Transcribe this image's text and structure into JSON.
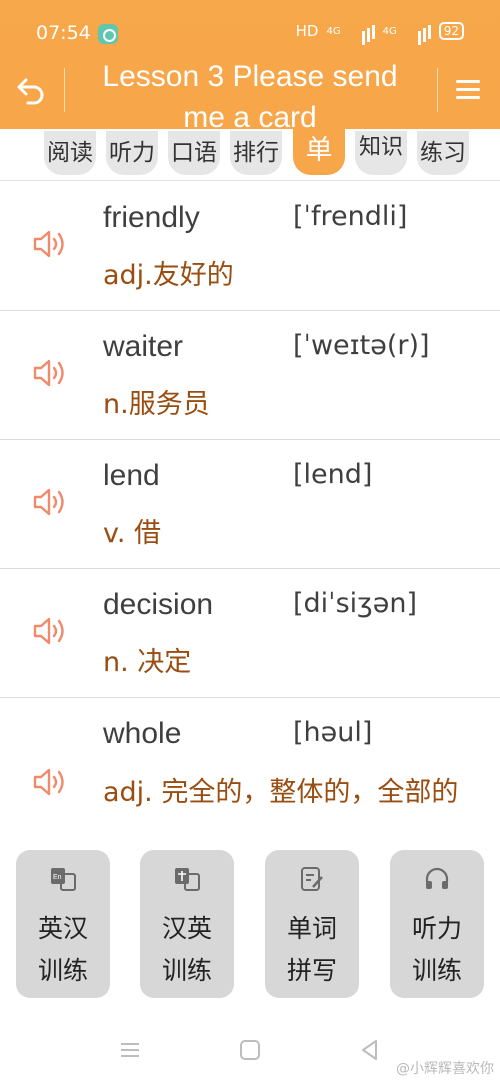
{
  "status_bar": {
    "time": "07:54",
    "network": "HD",
    "signal1": "4G",
    "signal2": "4G",
    "battery": "92"
  },
  "header": {
    "title": "Lesson 3 Please send me a card"
  },
  "tabs": [
    {
      "label": "阅读"
    },
    {
      "label": "听力"
    },
    {
      "label": "口语"
    },
    {
      "label": "排行"
    },
    {
      "label": "单",
      "active": true
    },
    {
      "label": "知识"
    },
    {
      "label": "练习"
    }
  ],
  "words": [
    {
      "word": "friendly",
      "phonetic": "[ˈfrendli]",
      "meaning": "adj.友好的"
    },
    {
      "word": "waiter",
      "phonetic": "[ˈweɪtə(r)]",
      "meaning": "n.服务员"
    },
    {
      "word": "lend",
      "phonetic": "[lend]",
      "meaning": "v. 借"
    },
    {
      "word": "decision",
      "phonetic": "[diˈsiʒən]",
      "meaning": "n. 决定"
    },
    {
      "word": "whole",
      "phonetic": "[həul]",
      "meaning": "adj. 完全的，整体的，全部的"
    }
  ],
  "training": [
    {
      "line1": "英汉",
      "line2": "训练",
      "icon": "en-cn-icon"
    },
    {
      "line1": "汉英",
      "line2": "训练",
      "icon": "cn-en-icon"
    },
    {
      "line1": "单词",
      "line2": "拼写",
      "icon": "edit-icon"
    },
    {
      "line1": "听力",
      "line2": "训练",
      "icon": "headphones-icon"
    }
  ],
  "watermark": "@小辉辉喜欢你",
  "colors": {
    "accent": "#f7a64a",
    "meaning": "#9a4d10",
    "speaker": "#f08a6a"
  }
}
